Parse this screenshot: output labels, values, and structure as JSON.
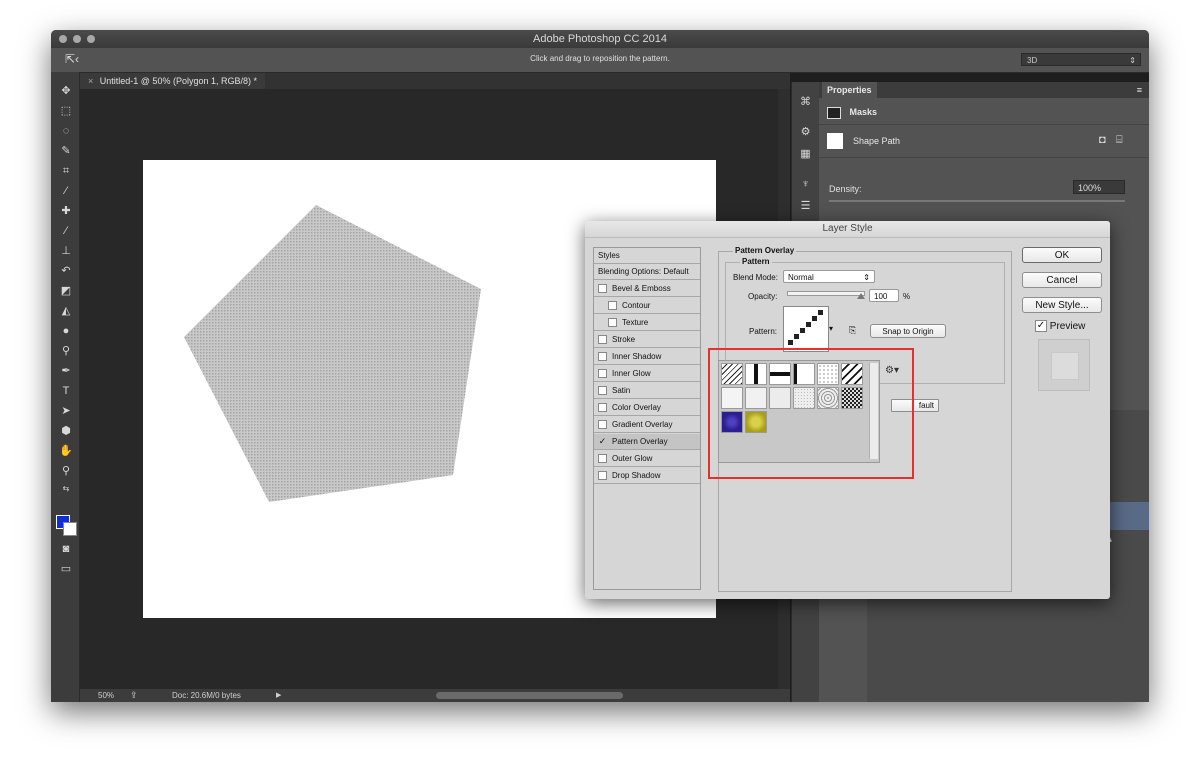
{
  "app": {
    "window_title": "Adobe Photoshop CC 2014",
    "options_hint": "Click and drag to reposition the pattern.",
    "workspace": "3D"
  },
  "document": {
    "tab_label": "Untitled-1 @ 50% (Polygon 1, RGB/8) *",
    "tab_close": "×"
  },
  "status": {
    "zoom": "50%",
    "doc_info": "Doc: 20.6M/0 bytes",
    "arrow": "▶"
  },
  "properties": {
    "tab": "Properties",
    "masks": "Masks",
    "shape_path": "Shape Path",
    "density_label": "Density:",
    "density_value": "100%"
  },
  "layer_style": {
    "title": "Layer Style",
    "styles_header": "Styles",
    "items": [
      {
        "label": "Blending Options: Default",
        "checkbox": false,
        "checked": false,
        "indent": false
      },
      {
        "label": "Bevel & Emboss",
        "checkbox": true,
        "checked": false,
        "indent": false
      },
      {
        "label": "Contour",
        "checkbox": true,
        "checked": false,
        "indent": true
      },
      {
        "label": "Texture",
        "checkbox": true,
        "checked": false,
        "indent": true
      },
      {
        "label": "Stroke",
        "checkbox": true,
        "checked": false,
        "indent": false
      },
      {
        "label": "Inner Shadow",
        "checkbox": true,
        "checked": false,
        "indent": false
      },
      {
        "label": "Inner Glow",
        "checkbox": true,
        "checked": false,
        "indent": false
      },
      {
        "label": "Satin",
        "checkbox": true,
        "checked": false,
        "indent": false
      },
      {
        "label": "Color Overlay",
        "checkbox": true,
        "checked": false,
        "indent": false
      },
      {
        "label": "Gradient Overlay",
        "checkbox": true,
        "checked": false,
        "indent": false
      },
      {
        "label": "Pattern Overlay",
        "checkbox": true,
        "checked": true,
        "indent": false
      },
      {
        "label": "Outer Glow",
        "checkbox": true,
        "checked": false,
        "indent": false
      },
      {
        "label": "Drop Shadow",
        "checkbox": true,
        "checked": false,
        "indent": false
      }
    ],
    "section_title": "Pattern Overlay",
    "group_title": "Pattern",
    "blend_mode_label": "Blend Mode:",
    "blend_mode_value": "Normal",
    "opacity_label": "Opacity:",
    "opacity_value": "100",
    "opacity_unit": "%",
    "pattern_label": "Pattern:",
    "snap_label": "Snap to Origin",
    "default_partial": "fault",
    "ok": "OK",
    "cancel": "Cancel",
    "new_style": "New Style...",
    "preview": "Preview",
    "preview_checked": true
  },
  "colors": {
    "foreground": "#0f2fd0",
    "background": "#ffffff",
    "highlight": "#e53030",
    "polygon": "#bdbdbd"
  },
  "icons": {
    "gear": "gear-icon",
    "settings": "settings-icon"
  }
}
